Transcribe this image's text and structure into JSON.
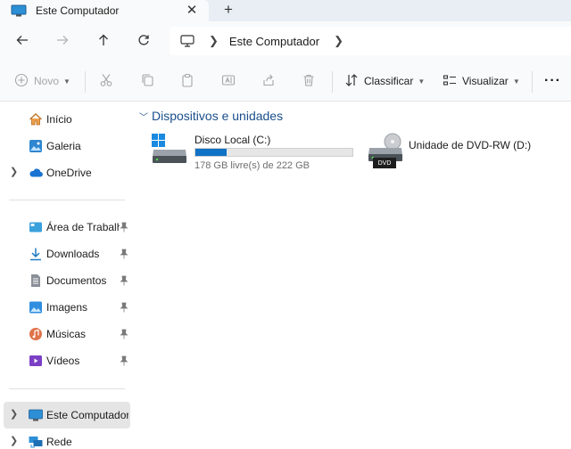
{
  "tab": {
    "title": "Este Computador",
    "close": "✕",
    "new_tab": "+"
  },
  "address": {
    "crumb": "Este Computador"
  },
  "toolbar": {
    "new_label": "Novo",
    "sort_label": "Classificar",
    "view_label": "Visualizar",
    "more_label": "···"
  },
  "sidebar": {
    "items": [
      {
        "label": "Início",
        "icon": "home-icon"
      },
      {
        "label": "Galeria",
        "icon": "gallery-icon"
      },
      {
        "label": "OneDrive",
        "icon": "cloud-icon"
      },
      {
        "label": "Área de Trabalho",
        "icon": "desktop-icon",
        "pinned": true
      },
      {
        "label": "Downloads",
        "icon": "download-icon",
        "pinned": true
      },
      {
        "label": "Documentos",
        "icon": "document-icon",
        "pinned": true
      },
      {
        "label": "Imagens",
        "icon": "pictures-icon",
        "pinned": true
      },
      {
        "label": "Músicas",
        "icon": "music-icon",
        "pinned": true
      },
      {
        "label": "Vídeos",
        "icon": "video-icon",
        "pinned": true
      },
      {
        "label": "Este Computador",
        "icon": "computer-icon",
        "selected": true
      },
      {
        "label": "Rede",
        "icon": "network-icon"
      }
    ]
  },
  "main": {
    "group_title": "Dispositivos e unidades",
    "drives": [
      {
        "name": "Disco Local (C:)",
        "free_text": "178 GB livre(s) de 222 GB",
        "used_fraction": 0.2
      },
      {
        "name": "Unidade de DVD-RW (D:)",
        "badge": "DVD"
      }
    ]
  },
  "colors": {
    "accent": "#0f72c4",
    "group_header": "#1a4e8a",
    "selected_bg": "#e5e5e5"
  }
}
